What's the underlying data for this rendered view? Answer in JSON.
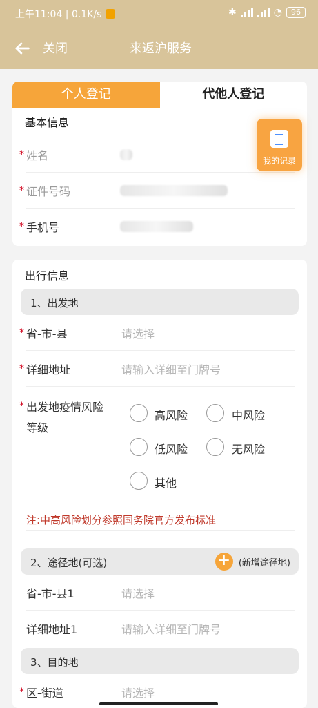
{
  "status": {
    "time_info": "上午11:04 | 0.1K/s",
    "battery": "96"
  },
  "header": {
    "close_label": "关闭",
    "title": "来返沪服务"
  },
  "tabs": {
    "personal": "个人登记",
    "others": "代他人登记"
  },
  "basic": {
    "section_title": "基本信息",
    "fields": [
      "姓名",
      "证件号码",
      "手机号"
    ]
  },
  "record_button": {
    "label": "我的记录"
  },
  "travel": {
    "section_title": "出行信息",
    "departure_header": "1、出发地",
    "province_label": "省-市-县",
    "province_placeholder": "请选择",
    "address_label": "详细地址",
    "address_placeholder": "请输入详细至门牌号",
    "risk_label_line1": "出发地疫情风险",
    "risk_label_line2": "等级",
    "risk_options": [
      "高风险",
      "中风险",
      "低风险",
      "无风险",
      "其他"
    ],
    "note": "注:中高风险划分参照国务院官方发布标准",
    "transit_header": "2、途径地(可选)",
    "add_transit": "(新增途径地)",
    "transit_province_label": "省-市-县1",
    "transit_province_placeholder": "请选择",
    "transit_address_label": "详细地址1",
    "transit_address_placeholder": "请输入详细至门牌号",
    "destination_header": "3、目的地",
    "district_label": "区-街道",
    "district_placeholder": "请选择"
  }
}
